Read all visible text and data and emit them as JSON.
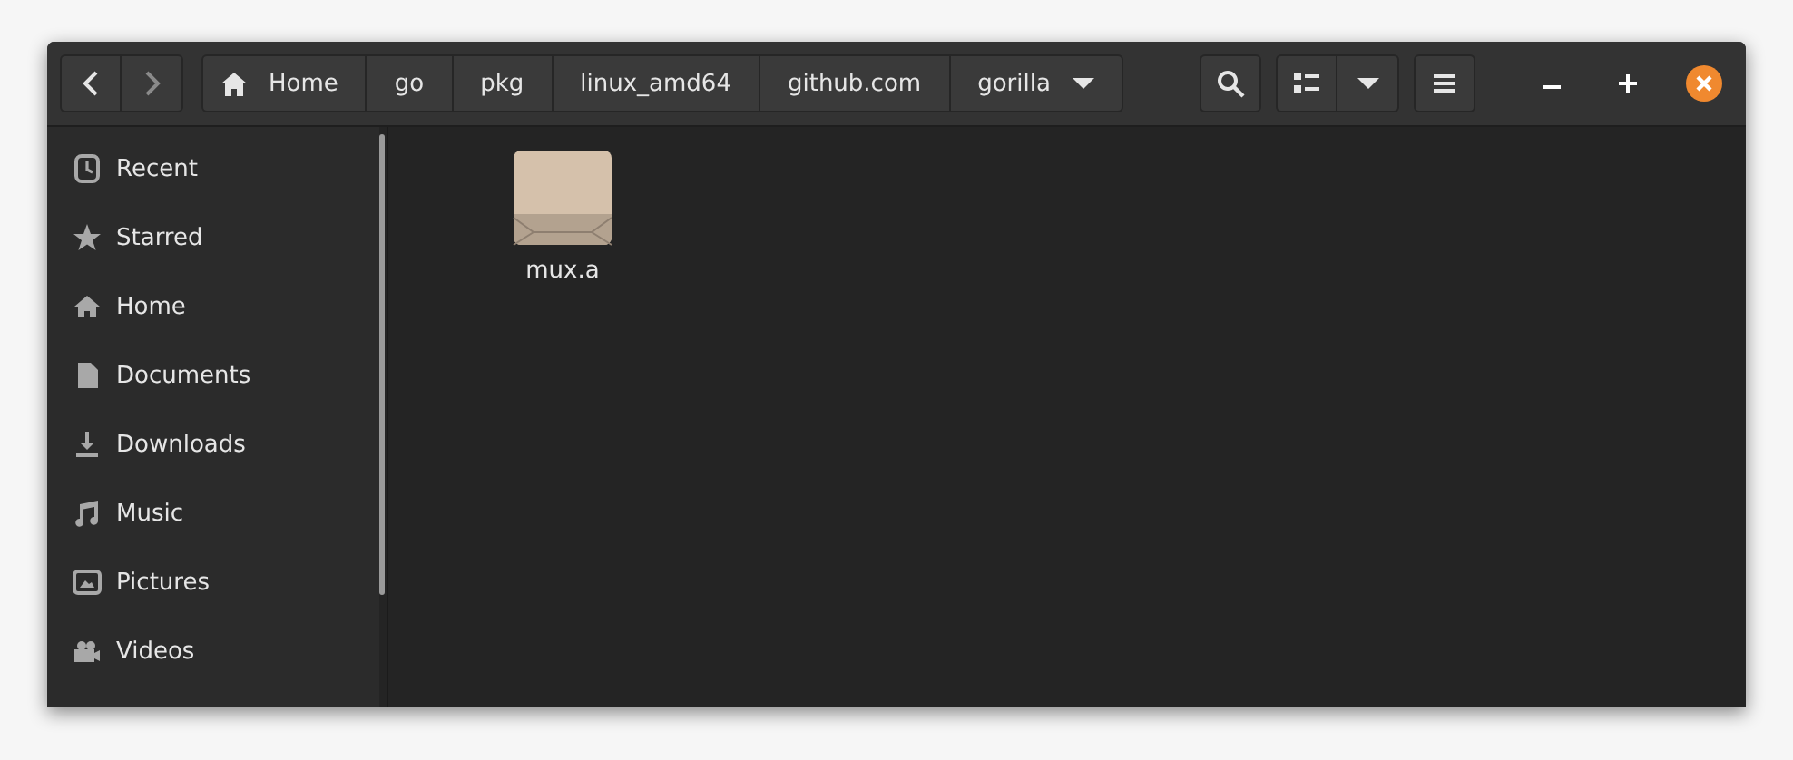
{
  "navigation": {
    "back_disabled": false,
    "forward_disabled": true
  },
  "breadcrumb": [
    {
      "label": "Home",
      "kind": "home"
    },
    {
      "label": "go",
      "kind": "folder"
    },
    {
      "label": "pkg",
      "kind": "folder"
    },
    {
      "label": "linux_amd64",
      "kind": "folder"
    },
    {
      "label": "github.com",
      "kind": "folder"
    },
    {
      "label": "gorilla",
      "kind": "current"
    }
  ],
  "sidebar": {
    "items": [
      {
        "label": "Recent",
        "kind": "recent"
      },
      {
        "label": "Starred",
        "kind": "starred"
      },
      {
        "label": "Home",
        "kind": "home"
      },
      {
        "label": "Documents",
        "kind": "documents"
      },
      {
        "label": "Downloads",
        "kind": "downloads"
      },
      {
        "label": "Music",
        "kind": "music"
      },
      {
        "label": "Pictures",
        "kind": "pictures"
      },
      {
        "label": "Videos",
        "kind": "videos"
      }
    ]
  },
  "files": [
    {
      "name": "mux.a",
      "kind": "archive"
    }
  ]
}
